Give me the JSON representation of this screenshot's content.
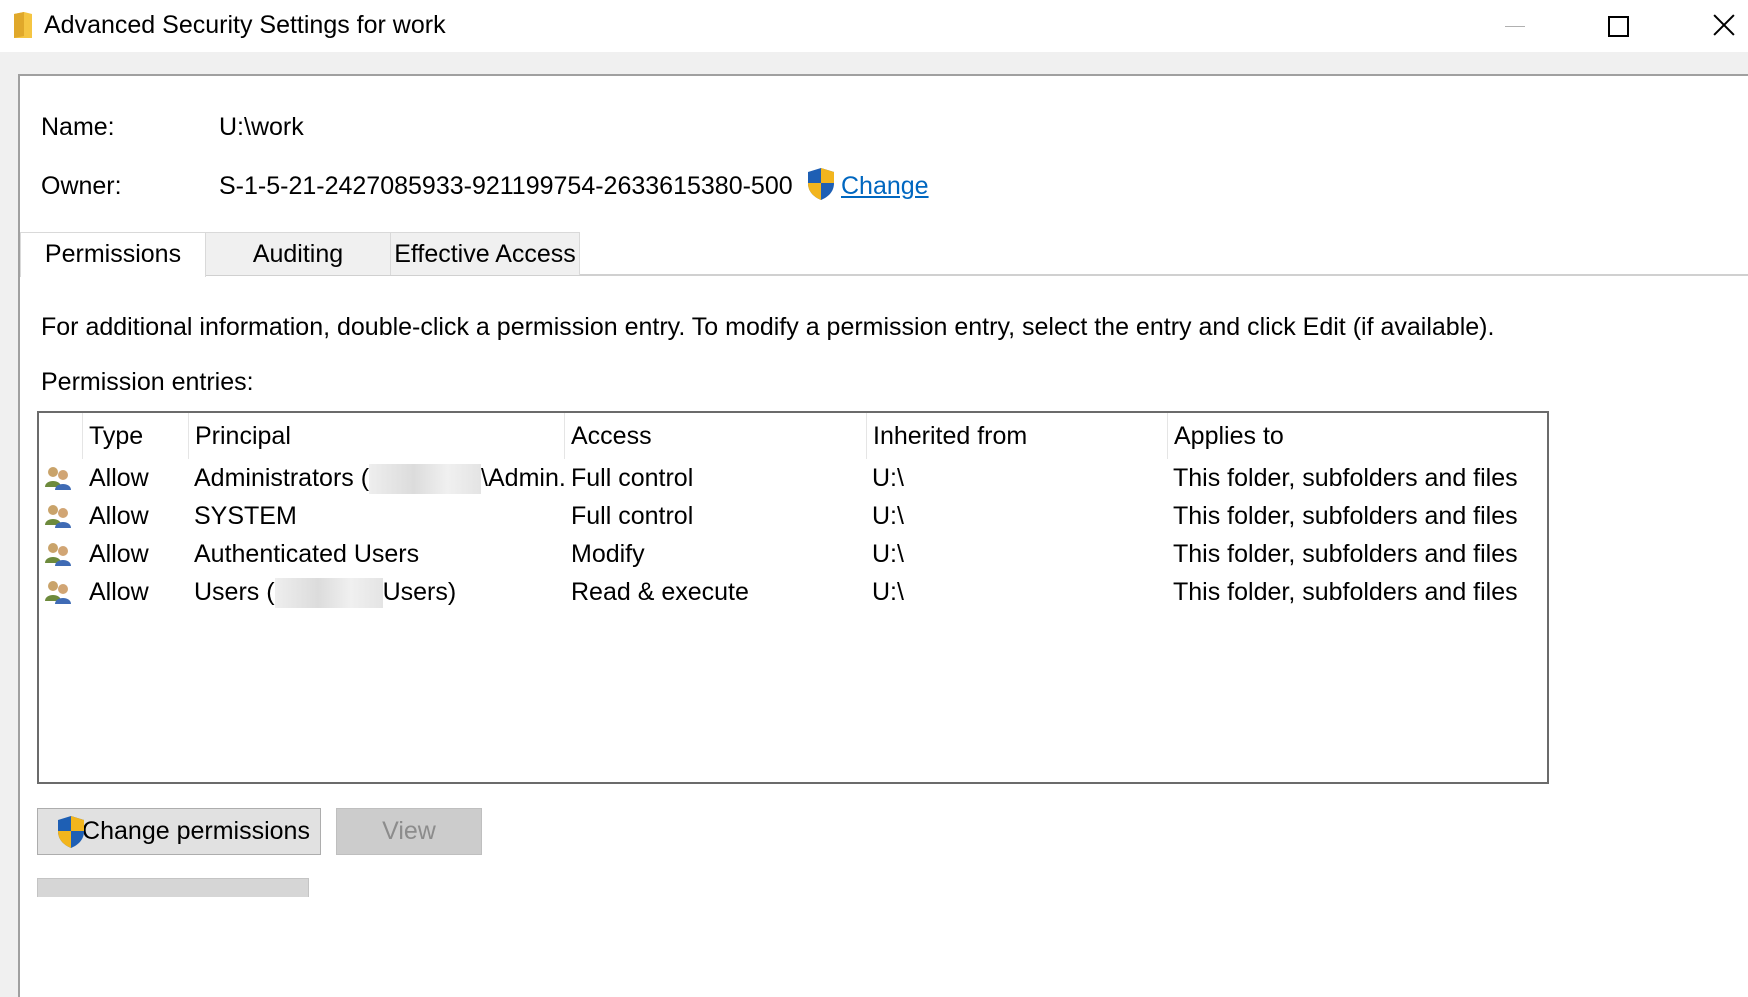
{
  "window": {
    "title": "Advanced Security Settings for work"
  },
  "info": {
    "name_label": "Name:",
    "name_value": "U:\\work",
    "owner_label": "Owner:",
    "owner_value": "S-1-5-21-2427085933-921199754-2633615380-500",
    "change_link": "Change"
  },
  "tabs": [
    {
      "label": "Permissions",
      "active": true
    },
    {
      "label": "Auditing",
      "active": false
    },
    {
      "label": "Effective Access",
      "active": false
    }
  ],
  "instructions": "For additional information, double-click a permission entry. To modify a permission entry, select the entry and click Edit (if available).",
  "entries_label": "Permission entries:",
  "table": {
    "columns": [
      "Type",
      "Principal",
      "Access",
      "Inherited from",
      "Applies to"
    ],
    "rows": [
      {
        "type": "Allow",
        "principal_pre": "Administrators (",
        "principal_post": "\\Admin...",
        "access": "Full control",
        "inherited": "U:\\",
        "applies": "This folder, subfolders and files"
      },
      {
        "type": "Allow",
        "principal_pre": "SYSTEM",
        "principal_post": "",
        "access": "Full control",
        "inherited": "U:\\",
        "applies": "This folder, subfolders and files"
      },
      {
        "type": "Allow",
        "principal_pre": "Authenticated Users",
        "principal_post": "",
        "access": "Modify",
        "inherited": "U:\\",
        "applies": "This folder, subfolders and files"
      },
      {
        "type": "Allow",
        "principal_pre": "Users (",
        "principal_post": "Users)",
        "access": "Read & execute",
        "inherited": "U:\\",
        "applies": "This folder, subfolders and files"
      }
    ]
  },
  "buttons": {
    "change_permissions": "Change permissions",
    "view": "View"
  },
  "colors": {
    "link": "#0067c0",
    "shield_blue": "#1e5fb4",
    "shield_yellow": "#f2b51d"
  }
}
